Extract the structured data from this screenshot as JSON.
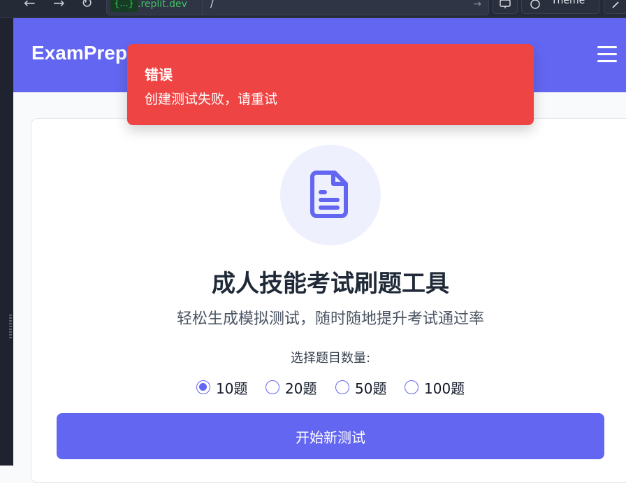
{
  "browser": {
    "url_badge": "{...}",
    "url_domain": ".replit.dev",
    "url_path": "/",
    "theme_label": "Theme"
  },
  "header": {
    "brand": "ExamPrep"
  },
  "toast": {
    "title": "错误",
    "message": "创建测试失败，请重试"
  },
  "main": {
    "title": "成人技能考试刷题工具",
    "subtitle": "轻松生成模拟测试，随时随地提升考试通过率",
    "count_label": "选择题目数量:",
    "options": [
      {
        "label": "10题",
        "checked": true
      },
      {
        "label": "20题",
        "checked": false
      },
      {
        "label": "50题",
        "checked": false
      },
      {
        "label": "100题",
        "checked": false
      }
    ],
    "start_button": "开始新测试"
  },
  "colors": {
    "primary": "#6366f1",
    "error": "#ef4444",
    "icon_bg": "#eef0fd"
  }
}
